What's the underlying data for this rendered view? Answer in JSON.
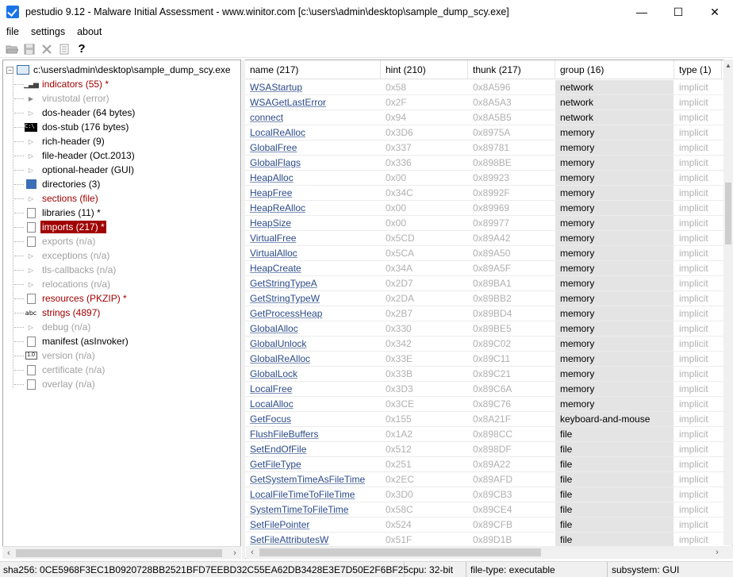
{
  "window": {
    "title": "pestudio 9.12 - Malware Initial Assessment - www.winitor.com [c:\\users\\admin\\desktop\\sample_dump_scy.exe]",
    "minimize": "—",
    "maximize": "☐",
    "close": "✕"
  },
  "menu": [
    "file",
    "settings",
    "about"
  ],
  "toolbar": {
    "open_icon": "open-icon",
    "save_icon": "save-icon",
    "close_icon": "close-icon",
    "list_icon": "list-icon",
    "help_icon": "help-icon"
  },
  "tree": {
    "root": "c:\\users\\admin\\desktop\\sample_dump_scy.exe",
    "items": [
      {
        "label": "indicators (55) *",
        "style": "red",
        "icon": "bars"
      },
      {
        "label": "virustotal (error)",
        "style": "gray",
        "icon": "arrow"
      },
      {
        "label": "dos-header (64 bytes)",
        "style": "black",
        "icon": "tri"
      },
      {
        "label": "dos-stub (176 bytes)",
        "style": "black",
        "icon": "stub"
      },
      {
        "label": "rich-header (9)",
        "style": "black",
        "icon": "tri"
      },
      {
        "label": "file-header (Oct.2013)",
        "style": "black",
        "icon": "tri"
      },
      {
        "label": "optional-header (GUI)",
        "style": "black",
        "icon": "tri"
      },
      {
        "label": "directories (3)",
        "style": "black",
        "icon": "dir"
      },
      {
        "label": "sections (file)",
        "style": "red",
        "icon": "tri"
      },
      {
        "label": "libraries (11) *",
        "style": "black",
        "icon": "page"
      },
      {
        "label": "imports (217) *",
        "style": "selected",
        "icon": "page"
      },
      {
        "label": "exports (n/a)",
        "style": "gray",
        "icon": "page"
      },
      {
        "label": "exceptions (n/a)",
        "style": "gray",
        "icon": "tri"
      },
      {
        "label": "tls-callbacks (n/a)",
        "style": "gray",
        "icon": "tri"
      },
      {
        "label": "relocations (n/a)",
        "style": "gray",
        "icon": "tri"
      },
      {
        "label": "resources (PKZIP) *",
        "style": "red",
        "icon": "page"
      },
      {
        "label": "strings (4897)",
        "style": "red",
        "icon": "abc"
      },
      {
        "label": "debug (n/a)",
        "style": "gray",
        "icon": "tri"
      },
      {
        "label": "manifest (asInvoker)",
        "style": "black",
        "icon": "page"
      },
      {
        "label": "version (n/a)",
        "style": "gray",
        "icon": "ver"
      },
      {
        "label": "certificate (n/a)",
        "style": "gray",
        "icon": "page"
      },
      {
        "label": "overlay (n/a)",
        "style": "gray",
        "icon": "page"
      }
    ]
  },
  "table": {
    "columns": [
      "name (217)",
      "hint (210)",
      "thunk (217)",
      "group (16)",
      "type (1)"
    ],
    "rows": [
      [
        "WSAStartup",
        "0x58",
        "0x8A596",
        "network",
        "implicit"
      ],
      [
        "WSAGetLastError",
        "0x2F",
        "0x8A5A3",
        "network",
        "implicit"
      ],
      [
        "connect",
        "0x94",
        "0x8A5B5",
        "network",
        "implicit"
      ],
      [
        "LocalReAlloc",
        "0x3D6",
        "0x8975A",
        "memory",
        "implicit"
      ],
      [
        "GlobalFree",
        "0x337",
        "0x89781",
        "memory",
        "implicit"
      ],
      [
        "GlobalFlags",
        "0x336",
        "0x898BE",
        "memory",
        "implicit"
      ],
      [
        "HeapAlloc",
        "0x00",
        "0x89923",
        "memory",
        "implicit"
      ],
      [
        "HeapFree",
        "0x34C",
        "0x8992F",
        "memory",
        "implicit"
      ],
      [
        "HeapReAlloc",
        "0x00",
        "0x89969",
        "memory",
        "implicit"
      ],
      [
        "HeapSize",
        "0x00",
        "0x89977",
        "memory",
        "implicit"
      ],
      [
        "VirtualFree",
        "0x5CD",
        "0x89A42",
        "memory",
        "implicit"
      ],
      [
        "VirtualAlloc",
        "0x5CA",
        "0x89A50",
        "memory",
        "implicit"
      ],
      [
        "HeapCreate",
        "0x34A",
        "0x89A5F",
        "memory",
        "implicit"
      ],
      [
        "GetStringTypeA",
        "0x2D7",
        "0x89BA1",
        "memory",
        "implicit"
      ],
      [
        "GetStringTypeW",
        "0x2DA",
        "0x89BB2",
        "memory",
        "implicit"
      ],
      [
        "GetProcessHeap",
        "0x2B7",
        "0x89BD4",
        "memory",
        "implicit"
      ],
      [
        "GlobalAlloc",
        "0x330",
        "0x89BE5",
        "memory",
        "implicit"
      ],
      [
        "GlobalUnlock",
        "0x342",
        "0x89C02",
        "memory",
        "implicit"
      ],
      [
        "GlobalReAlloc",
        "0x33E",
        "0x89C11",
        "memory",
        "implicit"
      ],
      [
        "GlobalLock",
        "0x33B",
        "0x89C21",
        "memory",
        "implicit"
      ],
      [
        "LocalFree",
        "0x3D3",
        "0x89C6A",
        "memory",
        "implicit"
      ],
      [
        "LocalAlloc",
        "0x3CE",
        "0x89C76",
        "memory",
        "implicit"
      ],
      [
        "GetFocus",
        "0x155",
        "0x8A21F",
        "keyboard-and-mouse",
        "implicit"
      ],
      [
        "FlushFileBuffers",
        "0x1A2",
        "0x898CC",
        "file",
        "implicit"
      ],
      [
        "SetEndOfFile",
        "0x512",
        "0x898DF",
        "file",
        "implicit"
      ],
      [
        "GetFileType",
        "0x251",
        "0x89A22",
        "file",
        "implicit"
      ],
      [
        "GetSystemTimeAsFileTime",
        "0x2EC",
        "0x89AFD",
        "file",
        "implicit"
      ],
      [
        "LocalFileTimeToFileTime",
        "0x3D0",
        "0x89CB3",
        "file",
        "implicit"
      ],
      [
        "SystemTimeToFileTime",
        "0x58C",
        "0x89CE4",
        "file",
        "implicit"
      ],
      [
        "SetFilePointer",
        "0x524",
        "0x89CFB",
        "file",
        "implicit"
      ],
      [
        "SetFileAttributesW",
        "0x51F",
        "0x89D1B",
        "file",
        "implicit"
      ]
    ]
  },
  "status": {
    "sha256": "sha256: 0CE5968F3EC1B0920728BB2521BFD7EEBD32C55EA62DB3428E3E7D50E2F6BF25",
    "cpu": "cpu: 32-bit",
    "filetype": "file-type: executable",
    "subsystem": "subsystem: GUI"
  },
  "colors": {
    "accent_red": "#a00000",
    "link_blue": "#2b4a8a",
    "group_bg": "#e4e4e4",
    "muted": "#b0b0b0"
  }
}
